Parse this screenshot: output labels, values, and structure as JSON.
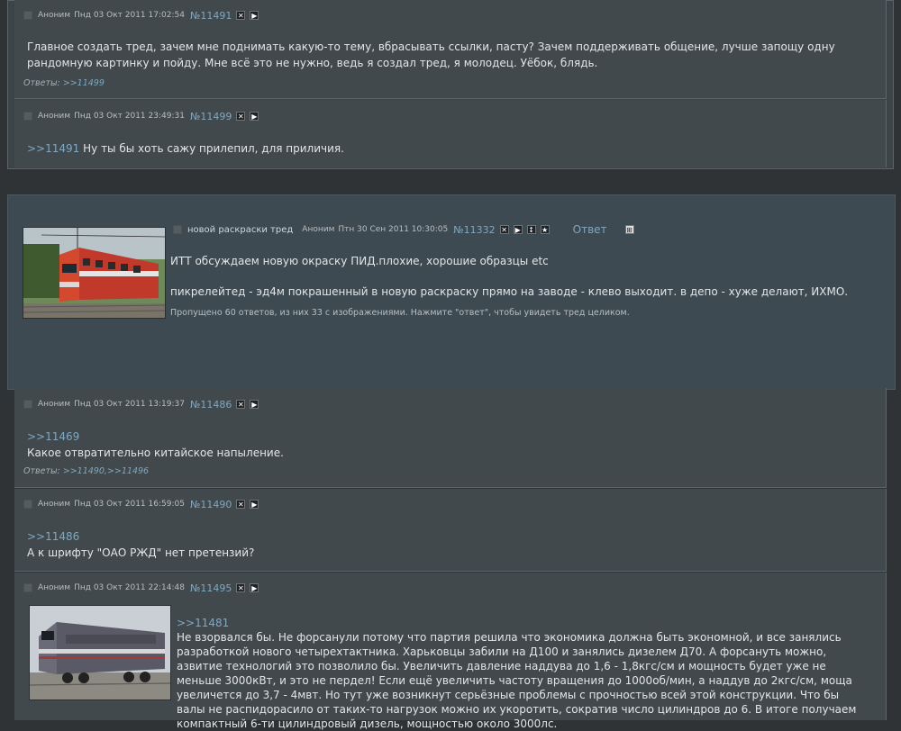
{
  "page": {
    "bg": "#2f3335",
    "link_color": "#7fa8c0"
  },
  "posts_top": [
    {
      "checkbox": "",
      "author": "Аноним",
      "date": "Пнд 03 Окт 2011 17:02:54",
      "num": "№11491",
      "text": "Главное создать тред, зачем мне поднимать какую-то тему, вбрасывать ссылки, пасту? Зачем поддерживать общение, лучше запощу одну рандомную картинку и пойду. Мне всё это не нужно, ведь я создал тред, я молодец. Уёбок, блядь.",
      "answers_label": "Ответы:",
      "answers": ">>11499"
    },
    {
      "author": "Аноним",
      "date": "Пнд 03 Окт 2011 23:49:31",
      "num": "№11499",
      "ref": ">>11491",
      "text": "Ну ты бы хоть сажу прилепил, для приличия."
    }
  ],
  "op": {
    "subject": "новой раскраски тред",
    "author": "Аноним",
    "date": "Птн 30 Сен 2011 10:30:05",
    "num": "№11332",
    "reply_label": "Ответ",
    "line1": "ИТТ обсуждаем новую окраску ПИД.плохие, хорошие образцы etc",
    "line2": "пикрелейтед - эд4м покрашенный в новую раскраску прямо на заводе - клево выходит. в депо - хуже делают, ИХМО.",
    "omitted": "Пропущено 60 ответов, из них 33 с изображениями. Нажмите \"ответ\", чтобы увидеть тред целиком.",
    "image_icon": "train-photo-red"
  },
  "replies": [
    {
      "author": "Аноним",
      "date": "Пнд 03 Окт 2011 13:19:37",
      "num": "№11486",
      "ref": ">>11469",
      "text": "Какое отвратительно китайское напыление.",
      "answers_label": "Ответы:",
      "answers": ">>11490,>>11496"
    },
    {
      "author": "Аноним",
      "date": "Пнд 03 Окт 2011 16:59:05",
      "num": "№11490",
      "ref": ">>11486",
      "text": "А к шрифту \"ОАО РЖД\" нет претензий?"
    },
    {
      "author": "Аноним",
      "date": "Пнд 03 Окт 2011 22:14:48",
      "num": "№11495",
      "ref": ">>11481",
      "text": "Не взорвался бы. Не форсанули потому что партия решила что экономика должна быть экономной, и все занялись разработкой нового четырехтактника. Харьковцы забили на Д100 и занялись дизелем Д70. А форсануть можно, азвитие технологий это позволило бы. Увеличить давление наддува до 1,6 - 1,8кгс/см и мощность будет уже не меньше 3000кВт, и это не пердел! Если ещё увеличить частоту вращения до 1000об/мин, а наддув до 2кгс/см, моща увеличется до 3,7 - 4мвт. Но тут уже возникнут серьёзные проблемы с прочностью всей этой конструкции. Что бы валы не распидорасило от таких-то нагрузок можно их укоротить, сократив число цилиндров до 6. В итоге получаем компактный 6-ти цилиндровый дизель, мощностью около 3000лс.",
      "image_icon": "train-photo-diesel"
    }
  ]
}
